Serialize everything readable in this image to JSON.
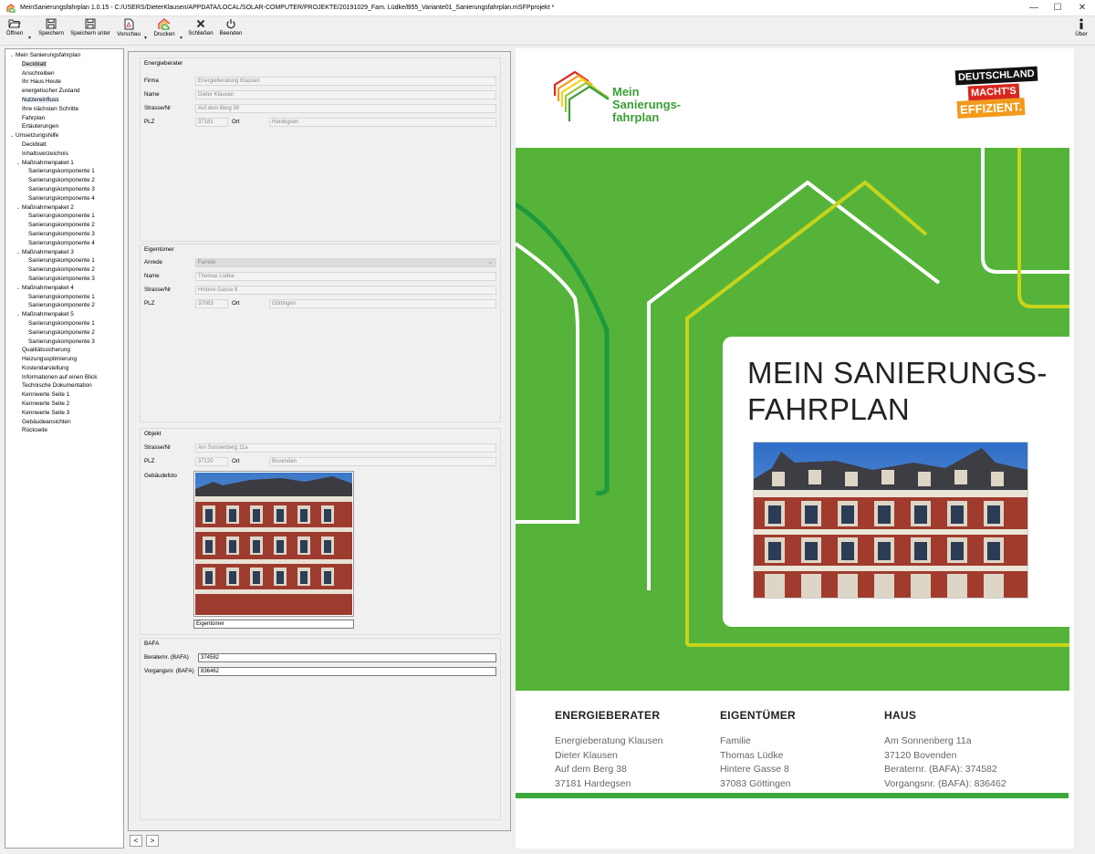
{
  "window": {
    "title": "MeinSanierungsfahrplan 1.0.15 - C:/USERS/DieterKlausen/APPDATA/LOCAL/SOLAR-COMPUTER/PROJEKTE/20191029_Fam. Lüdke/B55_Variante01_Sanierungsfahrplan.mSFPprojekt *",
    "minimize": "—",
    "maximize": "☐",
    "close": "✕"
  },
  "toolbar": {
    "open": "Öffnen",
    "save": "Speichern",
    "save_as": "Speichern unter",
    "preview": "Vorschau",
    "print": "Drucken",
    "close": "Schließen",
    "exit": "Beenden",
    "about": "Über",
    "arrow": "▾"
  },
  "tree": [
    {
      "label": "Mein Sanierungsfahrplan",
      "level": 0,
      "expander": "⌄"
    },
    {
      "label": "Deckblatt",
      "level": 1,
      "state": "selected"
    },
    {
      "label": "Anschreiben",
      "level": 1
    },
    {
      "label": "Ihr Haus Heute",
      "level": 1
    },
    {
      "label": "energetischer Zustand",
      "level": 1
    },
    {
      "label": "Nutzereinfluss",
      "level": 1,
      "state": "hover"
    },
    {
      "label": "Ihre nächsten Schritte",
      "level": 1
    },
    {
      "label": "Fahrplan",
      "level": 1
    },
    {
      "label": "Erläuterungen",
      "level": 1
    },
    {
      "label": "Umsetzungshilfe",
      "level": 0,
      "expander": "⌄"
    },
    {
      "label": "Deckblatt",
      "level": 1
    },
    {
      "label": "Inhaltsverzeichnis",
      "level": 1
    },
    {
      "label": "Maßnahmenpaket 1",
      "level": 1,
      "expander": "⌄"
    },
    {
      "label": "Sanierungskomponente 1",
      "level": 2
    },
    {
      "label": "Sanierungskomponente 2",
      "level": 2
    },
    {
      "label": "Sanierungskomponente 3",
      "level": 2
    },
    {
      "label": "Sanierungskomponente 4",
      "level": 2
    },
    {
      "label": "Maßnahmenpaket 2",
      "level": 1,
      "expander": "⌄"
    },
    {
      "label": "Sanierungskomponente 1",
      "level": 2
    },
    {
      "label": "Sanierungskomponente 2",
      "level": 2
    },
    {
      "label": "Sanierungskomponente 3",
      "level": 2
    },
    {
      "label": "Sanierungskomponente 4",
      "level": 2
    },
    {
      "label": "Maßnahmenpaket 3",
      "level": 1,
      "expander": "⌄"
    },
    {
      "label": "Sanierungskomponente 1",
      "level": 2
    },
    {
      "label": "Sanierungskomponente 2",
      "level": 2
    },
    {
      "label": "Sanierungskomponente 3",
      "level": 2
    },
    {
      "label": "Maßnahmenpaket 4",
      "level": 1,
      "expander": "⌄"
    },
    {
      "label": "Sanierungskomponente 1",
      "level": 2
    },
    {
      "label": "Sanierungskomponente 2",
      "level": 2
    },
    {
      "label": "Maßnahmenpaket 5",
      "level": 1,
      "expander": "⌄"
    },
    {
      "label": "Sanierungskomponente 1",
      "level": 2
    },
    {
      "label": "Sanierungskomponente 2",
      "level": 2
    },
    {
      "label": "Sanierungskomponente 3",
      "level": 2
    },
    {
      "label": "Qualitätssicherung",
      "level": 1
    },
    {
      "label": "Heizungsoptimierung",
      "level": 1
    },
    {
      "label": "Kostendarstellung",
      "level": 1
    },
    {
      "label": "Informationen auf einen Blick",
      "level": 1
    },
    {
      "label": "Technische Dokumentation",
      "level": 1
    },
    {
      "label": "Kennwerte Seite 1",
      "level": 1
    },
    {
      "label": "Kennwerte Seite 2",
      "level": 1
    },
    {
      "label": "Kennwerte Seite 3",
      "level": 1
    },
    {
      "label": "Gebäudeansichten",
      "level": 1
    },
    {
      "label": "Rückseite",
      "level": 1
    }
  ],
  "form": {
    "energieberater": {
      "title": "Energieberater",
      "firma_label": "Firma",
      "firma": "Energieberatung Klausen",
      "name_label": "Name",
      "name": "Dieter Klausen",
      "strasse_label": "Strasse/Nr",
      "strasse": "Auf dem Berg 38",
      "plz_label": "PLZ",
      "plz": "37181",
      "ort_label": "Ort",
      "ort": "Hardegsen"
    },
    "eigentuemer": {
      "title": "Eigentümer",
      "anrede_label": "Anrede",
      "anrede": "Familie",
      "name_label": "Name",
      "name": "Thomas Lüdke",
      "strasse_label": "Strasse/Nr",
      "strasse": "Hintere Gasse 8",
      "plz_label": "PLZ",
      "plz": "37083",
      "ort_label": "Ort",
      "ort": "Göttingen"
    },
    "objekt": {
      "title": "Objekt",
      "strasse_label": "Strasse/Nr",
      "strasse": "Am Sonnenberg 11a",
      "plz_label": "PLZ",
      "plz": "37120",
      "ort_label": "Ort",
      "ort": "Bovenden",
      "foto_label": "Gebäudefoto",
      "foto_caption": "Eigentümer"
    },
    "bafa": {
      "title": "BAFA",
      "beraternr_label": "Beraternr. (BAFA)",
      "beraternr": "374582",
      "vorgangsnr_label": "Vorgangsnr. (BAFA)",
      "vorgangsnr": "836462"
    },
    "pager_prev": "<",
    "pager_next": ">"
  },
  "preview": {
    "logo_line1": "Mein",
    "logo_line2": "Sanierungs-",
    "logo_line3": "fahrplan",
    "badge_line1": "DEUTSCHLAND",
    "badge_line2": "MACHT'S",
    "badge_line3": "EFFIZIENT.",
    "title_line1": "MEIN SANIERUNGS-",
    "title_line2": "FAHRPLAN",
    "col1": {
      "heading": "ENERGIEBERATER",
      "lines": [
        "Energieberatung Klausen",
        "Dieter Klausen",
        "Auf dem Berg 38",
        "37181 Hardegsen"
      ]
    },
    "col2": {
      "heading": "EIGENTÜMER",
      "lines": [
        "Familie",
        "Thomas Lüdke",
        "Hintere Gasse 8",
        "37083 Göttingen"
      ]
    },
    "col3": {
      "heading": "HAUS",
      "lines": [
        "Am Sonnenberg 11a",
        "37120 Bovenden",
        "Beraternr. (BAFA): 374582",
        "Vorgangsnr. (BAFA): 836462"
      ]
    }
  },
  "colors": {
    "brand_green": "#55b33a",
    "accent_yellow": "#c8d419",
    "dark_green": "#1e9a3c"
  }
}
